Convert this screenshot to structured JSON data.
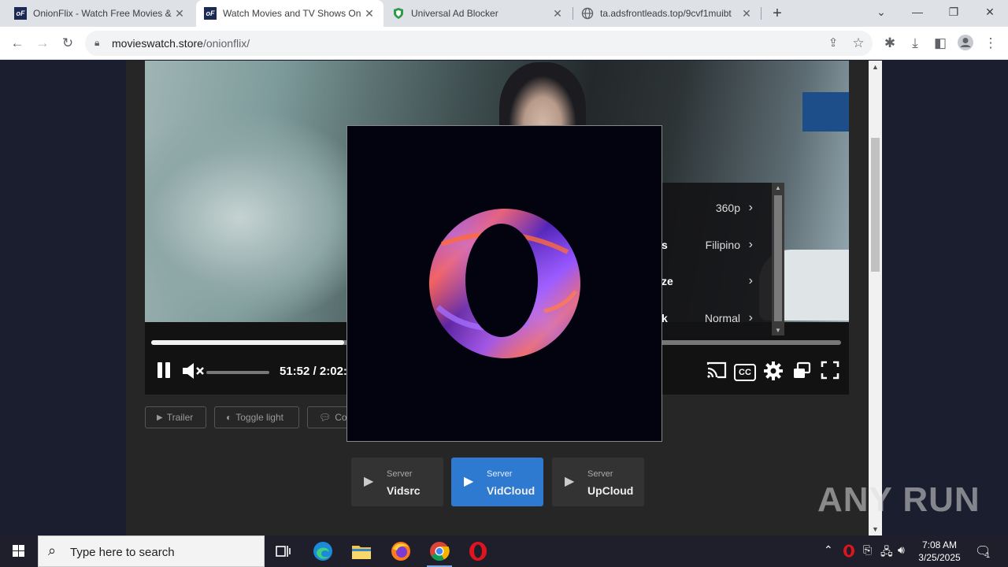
{
  "tabs": [
    {
      "title": "OnionFlix - Watch Free Movies &",
      "favicon": "onionflix-logo"
    },
    {
      "title": "Watch Movies and TV Shows On",
      "favicon": "onionflix-logo"
    },
    {
      "title": "Universal Ad Blocker",
      "favicon": "shield-icon"
    },
    {
      "title": "ta.adsfrontleads.top/9cvf1muibt",
      "favicon": "globe-icon"
    }
  ],
  "address_bar": {
    "host": "movieswatch.store",
    "path": "/onionflix/"
  },
  "player": {
    "time_current": "51:52",
    "time_separator": " / ",
    "time_total": "2:02:",
    "progress_fraction": 0.28,
    "settings": [
      {
        "label": "",
        "value": "360p"
      },
      {
        "label": "s",
        "value": "Filipino"
      },
      {
        "label": "ze",
        "value": ""
      },
      {
        "label": "k",
        "value": "Normal"
      }
    ],
    "cc_label": "CC"
  },
  "actions": [
    {
      "label": "Trailer",
      "icon": "youtube-icon"
    },
    {
      "label": "Toggle light",
      "icon": "contrast-icon"
    },
    {
      "label": "Con",
      "icon": "comment-icon"
    }
  ],
  "servers": [
    {
      "small": "Server",
      "name": "Vidsrc",
      "active": false
    },
    {
      "small": "Server",
      "name": "VidCloud",
      "active": true
    },
    {
      "small": "Server",
      "name": "UpCloud",
      "active": false
    }
  ],
  "watermark": "ANY RUN",
  "taskbar": {
    "search_placeholder": "Type here to search",
    "time": "7:08 AM",
    "date": "3/25/2025",
    "notification_count": "1"
  },
  "colors": {
    "active_server": "#2e7ad1",
    "page_bg": "#1b1e2e",
    "popup_bg": "#03020f"
  }
}
